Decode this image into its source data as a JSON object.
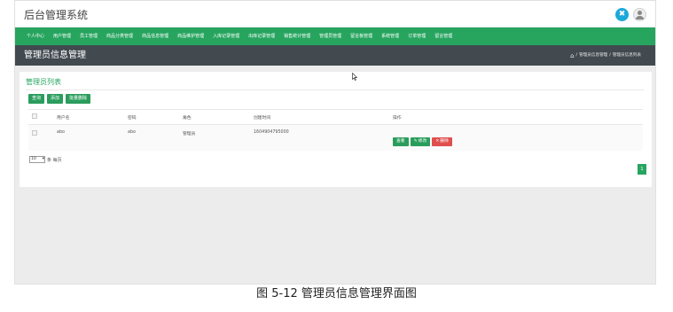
{
  "app": {
    "title": "后台管理系统"
  },
  "nav": {
    "items": [
      "个人中心",
      "用户管理",
      "员工管理",
      "商品分类管理",
      "商品信息管理",
      "商品维护管理",
      "入库记录管理",
      "出库记录管理",
      "销售统计管理",
      "管理员管理",
      "留言板管理",
      "系统管理",
      "订单管理",
      "留言管理"
    ]
  },
  "header": {
    "page_title": "管理员信息管理",
    "breadcrumb": [
      "管理员信息管理",
      "管理员信息列表"
    ]
  },
  "card": {
    "title": "管理员列表",
    "buttons": {
      "search": "查询",
      "add": "添加",
      "batch_delete": "批量删除"
    }
  },
  "table": {
    "columns": [
      "",
      "用户名",
      "密码",
      "角色",
      "创建时间",
      "操作"
    ],
    "rows": [
      {
        "username": "abo",
        "password": "abo",
        "role": "管理员",
        "created": "1604904795000"
      }
    ],
    "actions": {
      "view": "查看",
      "edit": "修改",
      "delete": "删除"
    }
  },
  "pagination": {
    "page_size": "10",
    "page_size_suffix": "条 每页",
    "current_page": "1"
  },
  "caption": "图 5-12 管理员信息管理界面图",
  "colors": {
    "primary": "#27a55f",
    "title_bar": "#424a50",
    "danger": "#e04e4e",
    "accent_blue": "#1ca8d8"
  },
  "icons": {
    "shuffle": "shuffle-icon",
    "avatar": "user-icon",
    "home": "home-icon",
    "edit": "edit-icon",
    "delete": "delete-icon"
  }
}
